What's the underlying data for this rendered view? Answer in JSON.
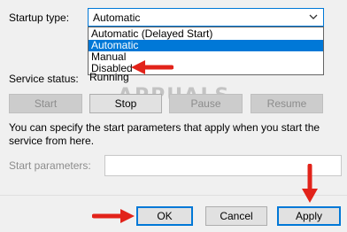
{
  "startup": {
    "label": "Startup type:",
    "selected_value": "Automatic",
    "options": [
      "Automatic (Delayed Start)",
      "Automatic",
      "Manual",
      "Disabled"
    ],
    "highlighted_option": "Automatic"
  },
  "service_status": {
    "label": "Service status:",
    "value": "Running"
  },
  "control_buttons": {
    "start": "Start",
    "stop": "Stop",
    "pause": "Pause",
    "resume": "Resume"
  },
  "help_text": "You can specify the start parameters that apply when you start the service from here.",
  "start_parameters": {
    "label": "Start parameters:",
    "value": ""
  },
  "footer": {
    "ok": "OK",
    "cancel": "Cancel",
    "apply": "Apply"
  },
  "watermark": "APPUALS",
  "colors": {
    "accent": "#0078d7",
    "annotation_arrow": "#e2231a"
  },
  "icons": [
    "chevron-down-icon",
    "annotation-arrow-icon"
  ]
}
